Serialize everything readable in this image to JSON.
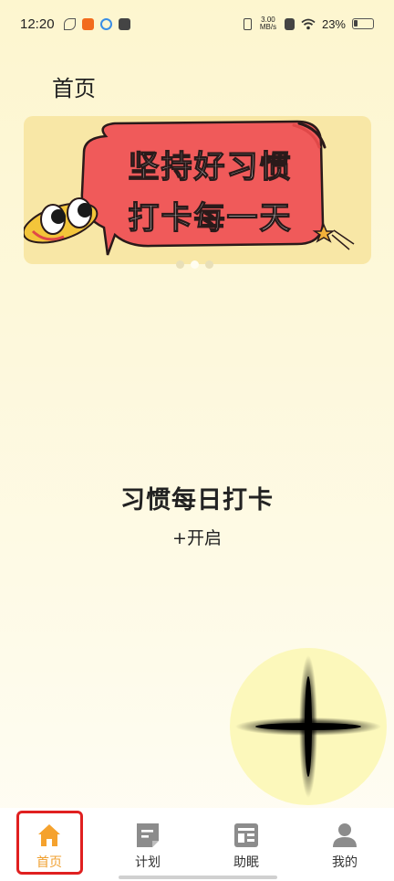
{
  "status_bar": {
    "time": "12:20",
    "net_speed_value": "3.00",
    "net_speed_unit": "MB/s",
    "battery_text": "23%",
    "battery_level": 0.23
  },
  "page": {
    "title": "首页"
  },
  "banner": {
    "line1": "坚持好习惯",
    "line2": "打卡每一天",
    "bubble_color": "#f05a5a",
    "background_color": "#f8e7a6",
    "pager_total": 3,
    "pager_active": 2
  },
  "habit": {
    "title": "习惯每日打卡",
    "start_label": "+开启"
  },
  "tab_bar": {
    "active_color": "#f0a030",
    "items": [
      {
        "label": "首页",
        "icon": "home-icon",
        "active": true
      },
      {
        "label": "计划",
        "icon": "plan-icon",
        "active": false
      },
      {
        "label": "助眠",
        "icon": "sleep-aid-icon",
        "active": false
      },
      {
        "label": "我的",
        "icon": "profile-icon",
        "active": false
      }
    ]
  }
}
